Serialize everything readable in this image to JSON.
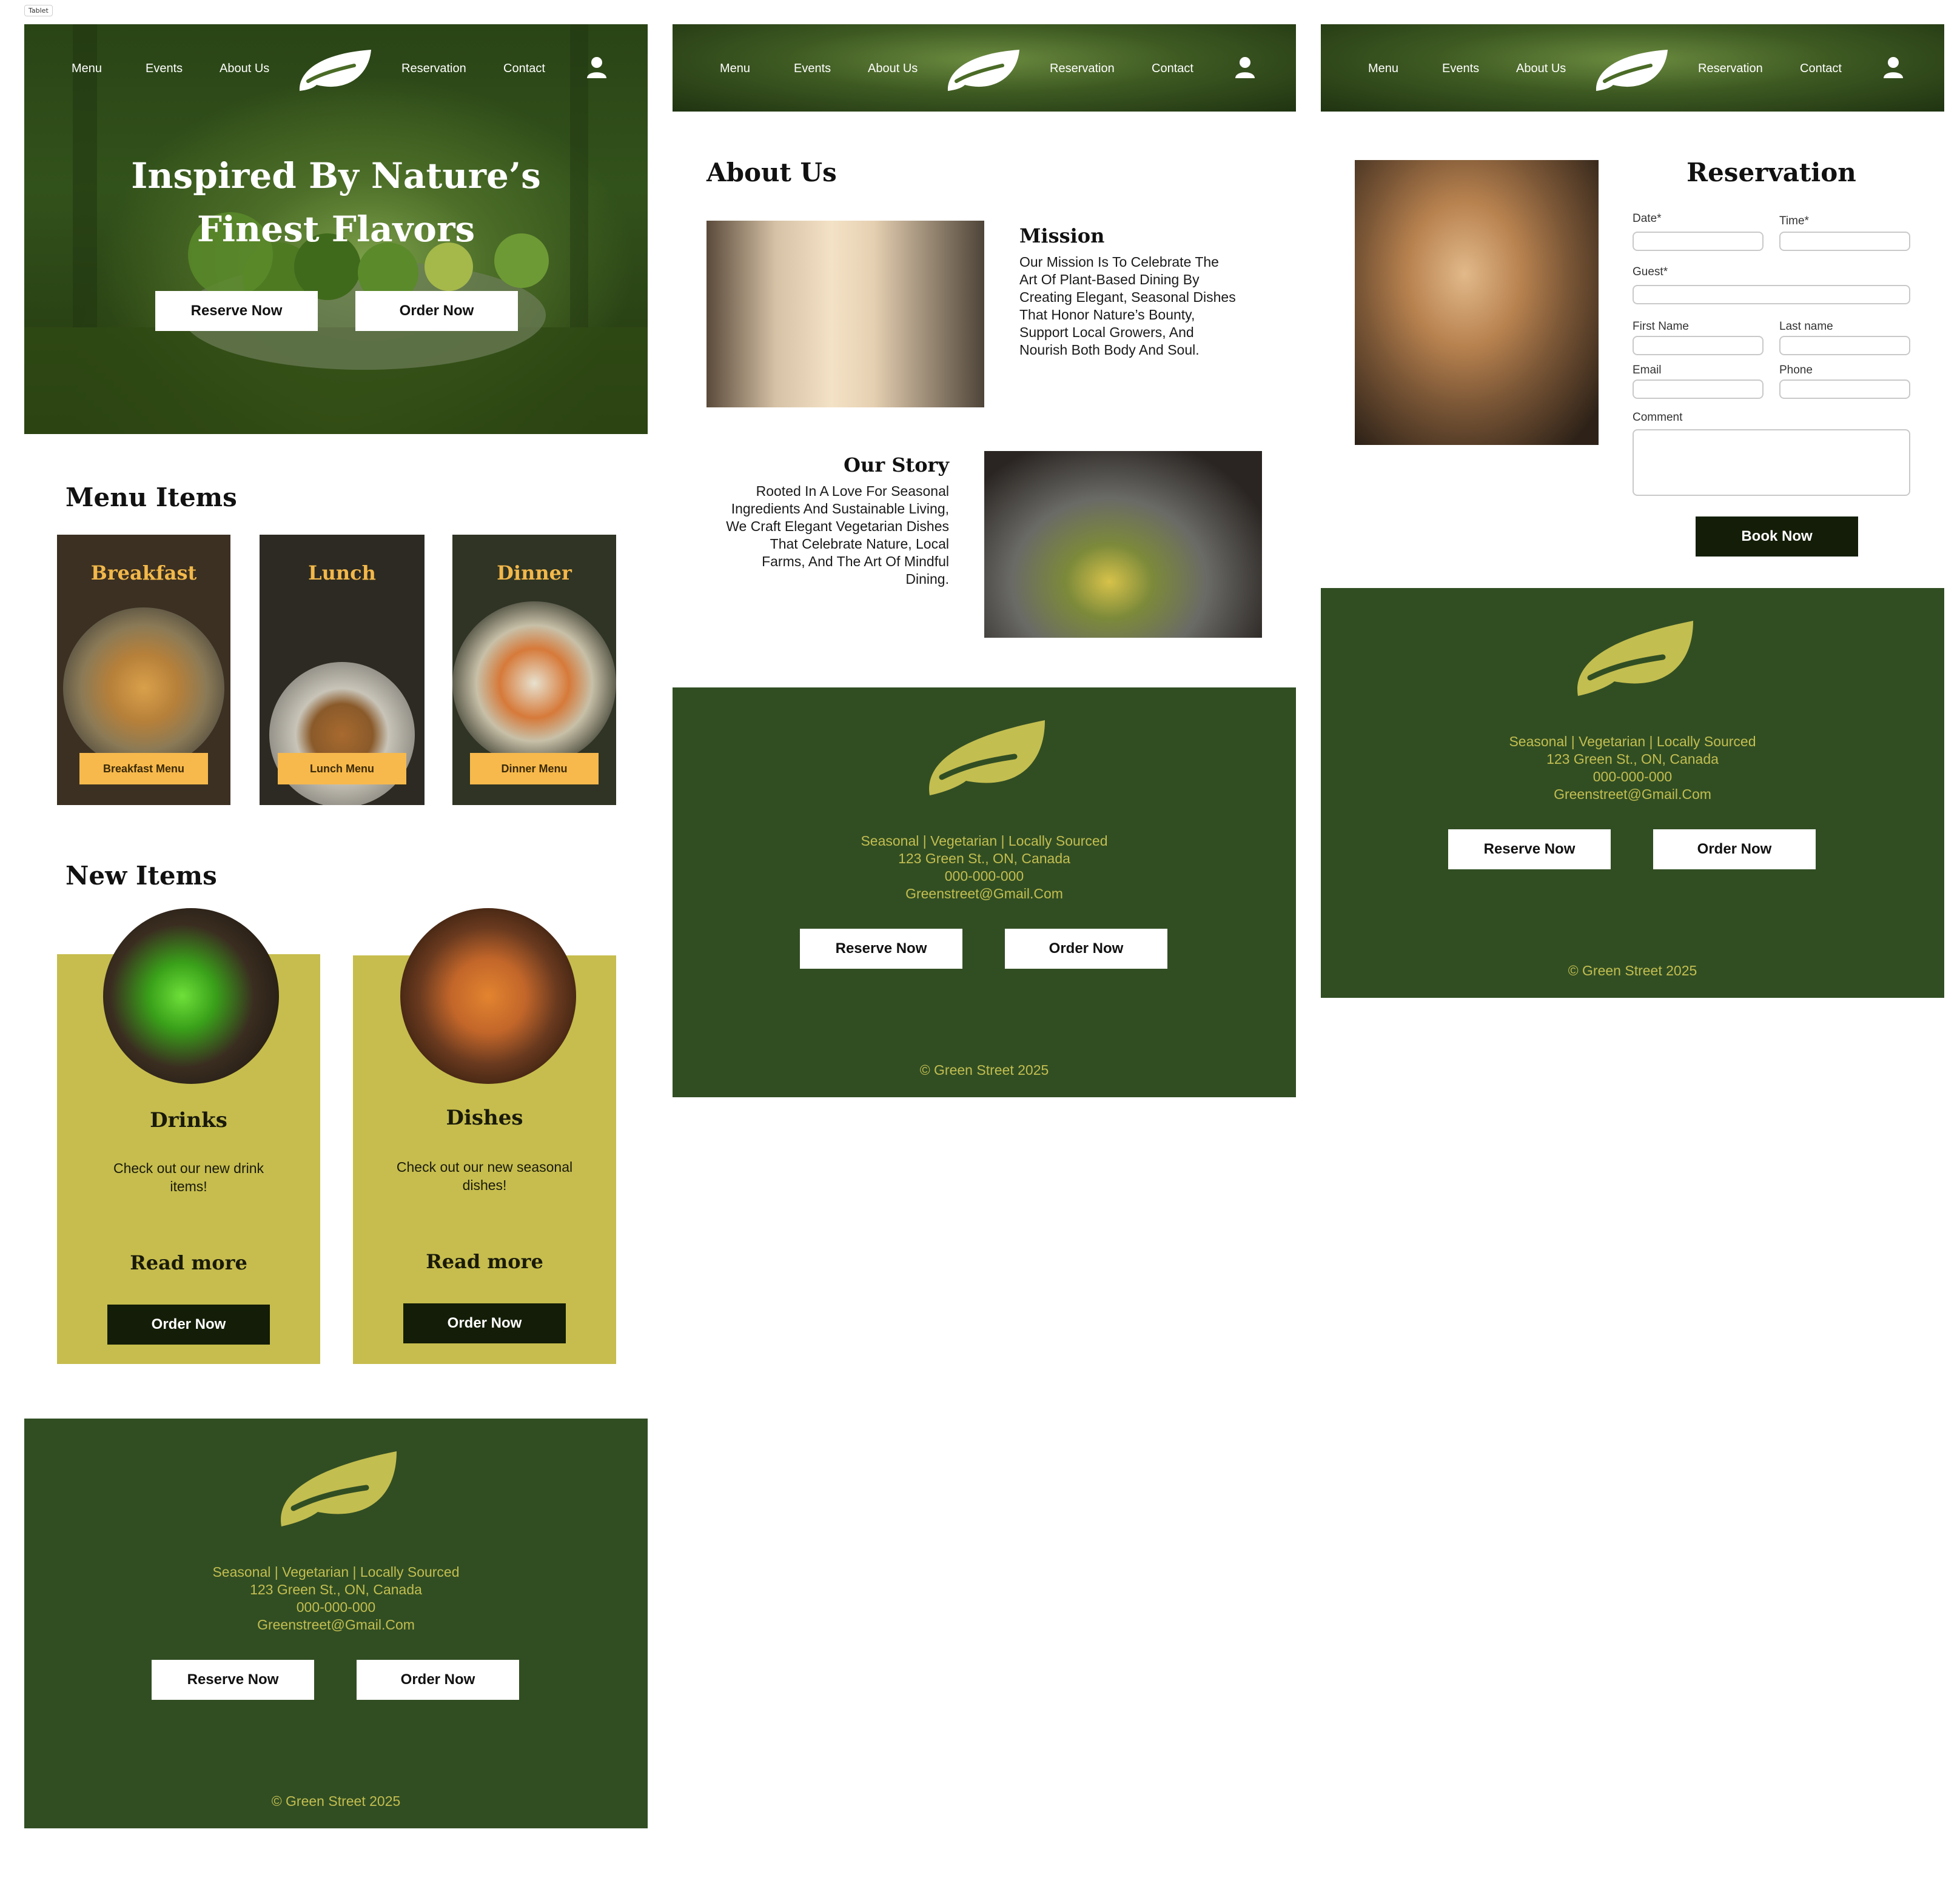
{
  "frame_label": "Tablet",
  "nav": {
    "menu": "Menu",
    "events": "Events",
    "about": "About Us",
    "reservation": "Reservation",
    "contact": "Contact"
  },
  "hero": {
    "title_line1": "Inspired By Nature’s",
    "title_line2": "Finest Flavors",
    "reserve_label": "Reserve Now",
    "order_label": "Order Now"
  },
  "menu_section": {
    "title": "Menu Items",
    "cards": [
      {
        "title": "Breakfast",
        "button": "Breakfast Menu"
      },
      {
        "title": "Lunch",
        "button": "Lunch Menu"
      },
      {
        "title": "Dinner",
        "button": "Dinner Menu"
      }
    ]
  },
  "new_section": {
    "title": "New Items",
    "cards": [
      {
        "title": "Drinks",
        "text": "Check out our new drink items!",
        "read": "Read more",
        "button": "Order Now"
      },
      {
        "title": "Dishes",
        "text": "Check out our new seasonal dishes!",
        "read": "Read more",
        "button": "Order Now"
      }
    ]
  },
  "footer": {
    "tagline": "Seasonal | Vegetarian | Locally Sourced",
    "address": "123 Green St., ON, Canada",
    "phone": "000-000-000",
    "email": "Greenstreet@Gmail.Com",
    "reserve_label": "Reserve Now",
    "order_label": "Order Now",
    "copyright": "© Green Street 2025"
  },
  "about": {
    "title": "About Us",
    "mission_title": "Mission",
    "mission_lines": [
      "Our Mission Is To Celebrate The",
      "Art Of Plant-Based Dining By",
      "Creating Elegant, Seasonal Dishes",
      "That Honor Nature’s Bounty,",
      "Support Local Growers, And",
      "Nourish Both Body And Soul."
    ],
    "story_title": "Our Story",
    "story_lines": [
      "Rooted In A Love For Seasonal",
      "Ingredients And Sustainable Living,",
      "We Craft Elegant Vegetarian Dishes",
      "That Celebrate Nature, Local",
      "Farms, And The Art Of Mindful",
      "Dining."
    ]
  },
  "reservation": {
    "title": "Reservation",
    "date_label": "Date*",
    "time_label": "Time*",
    "guest_label": "Guest*",
    "first_name_label": "First Name",
    "last_name_label": "Last name",
    "email_label": "Email",
    "phone_label": "Phone",
    "comment_label": "Comment",
    "book_label": "Book Now"
  },
  "colors": {
    "footer_bg": "#314e23",
    "footer_text": "#c3be50",
    "accent_yellow": "#f7b94c",
    "card_olive": "#c6bd4e",
    "dark_button": "#131d07"
  }
}
